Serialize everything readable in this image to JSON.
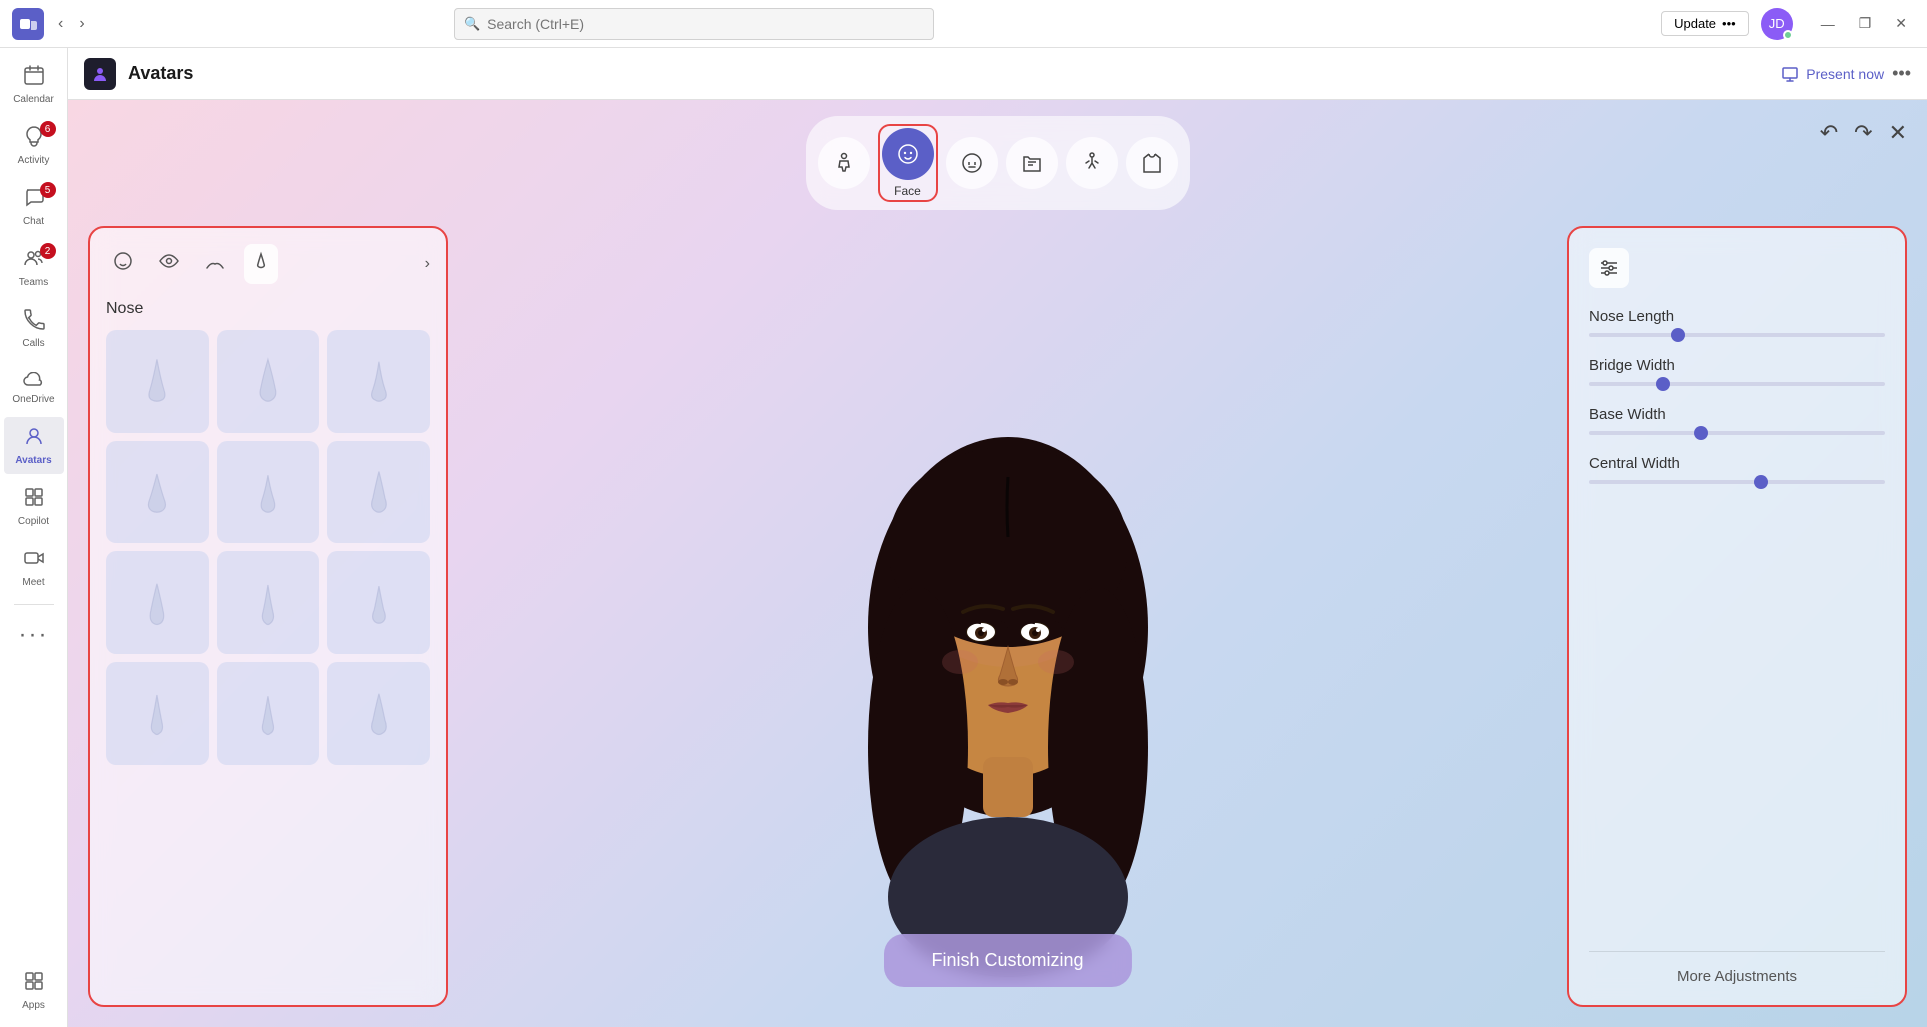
{
  "titlebar": {
    "search_placeholder": "Search (Ctrl+E)",
    "update_label": "Update",
    "update_dots": "•••",
    "minimize_label": "—",
    "maximize_label": "❐",
    "close_label": "✕"
  },
  "sidebar": {
    "items": [
      {
        "id": "calendar",
        "label": "Calendar",
        "icon": "📅",
        "badge": null
      },
      {
        "id": "activity",
        "label": "Activity",
        "icon": "🔔",
        "badge": "6"
      },
      {
        "id": "chat",
        "label": "Chat",
        "icon": "💬",
        "badge": "5"
      },
      {
        "id": "teams",
        "label": "Teams",
        "icon": "👥",
        "badge": "2"
      },
      {
        "id": "calls",
        "label": "Calls",
        "icon": "📞",
        "badge": null
      },
      {
        "id": "onedrive",
        "label": "OneDrive",
        "icon": "☁",
        "badge": null
      },
      {
        "id": "avatars",
        "label": "Avatars",
        "icon": "👤",
        "badge": null,
        "active": true
      },
      {
        "id": "copilot",
        "label": "Copilot",
        "icon": "⊞",
        "badge": null
      },
      {
        "id": "meet",
        "label": "Meet",
        "icon": "📷",
        "badge": null
      },
      {
        "id": "more",
        "label": "•••",
        "icon": "•••",
        "badge": null
      },
      {
        "id": "apps",
        "label": "Apps",
        "icon": "⊞",
        "badge": null
      }
    ]
  },
  "header": {
    "app_icon": "👤",
    "title": "Avatars",
    "present_now": "Present now",
    "more_options": "•••"
  },
  "category_bar": {
    "categories": [
      {
        "id": "body",
        "icon": "🧍",
        "label": ""
      },
      {
        "id": "face",
        "icon": "😊",
        "label": "Face",
        "active": true
      },
      {
        "id": "expression",
        "icon": "😐",
        "label": ""
      },
      {
        "id": "style",
        "icon": "👔",
        "label": ""
      },
      {
        "id": "pose",
        "icon": "🤸",
        "label": ""
      },
      {
        "id": "outfit",
        "icon": "👕",
        "label": ""
      }
    ]
  },
  "editor_actions": {
    "undo": "↶",
    "redo": "↷",
    "close": "✕"
  },
  "left_panel": {
    "tabs": [
      {
        "id": "face-shape",
        "icon": "🙂"
      },
      {
        "id": "eyes",
        "icon": "👁"
      },
      {
        "id": "eyebrows",
        "icon": "〰"
      },
      {
        "id": "nose",
        "icon": "👃",
        "active": true
      }
    ],
    "next_icon": "›",
    "section_label": "Nose",
    "nose_items_count": 12
  },
  "right_panel": {
    "filter_icon": "⊟",
    "sliders": [
      {
        "id": "nose-length",
        "label": "Nose Length",
        "value": 30
      },
      {
        "id": "bridge-width",
        "label": "Bridge Width",
        "value": 25
      },
      {
        "id": "base-width",
        "label": "Base Width",
        "value": 38
      },
      {
        "id": "central-width",
        "label": "Central Width",
        "value": 58
      }
    ],
    "more_adjustments": "More Adjustments"
  },
  "finish_button": {
    "label": "Finish Customizing"
  },
  "colors": {
    "accent": "#5b5fc7",
    "red_border": "#e84444",
    "active_cat_bg": "#5b5fc7",
    "finish_bg": "rgba(170,150,220,0.85)"
  }
}
